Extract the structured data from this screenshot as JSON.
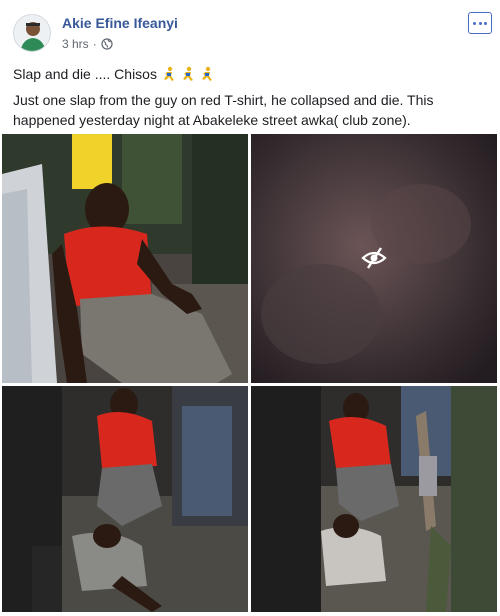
{
  "post": {
    "author": "Akie Efine Ifeanyi",
    "time": "3 hrs",
    "separator": "·",
    "headline_text": "Slap and die .... Chisos",
    "body_line1": "Just one slap from the guy on red T-shirt, he collapsed and die. This",
    "body_line2": "happened yesterday night at Abakeleke street awka( club zone)."
  },
  "icons": {
    "audience": "globe-icon",
    "more": "more-options-icon",
    "runner": "running-person-emoji",
    "sensitive": "eye-slash-icon"
  },
  "colors": {
    "author": "#385898",
    "text": "#1c1e21",
    "meta": "#616770",
    "accent": "#4b6bc4"
  }
}
